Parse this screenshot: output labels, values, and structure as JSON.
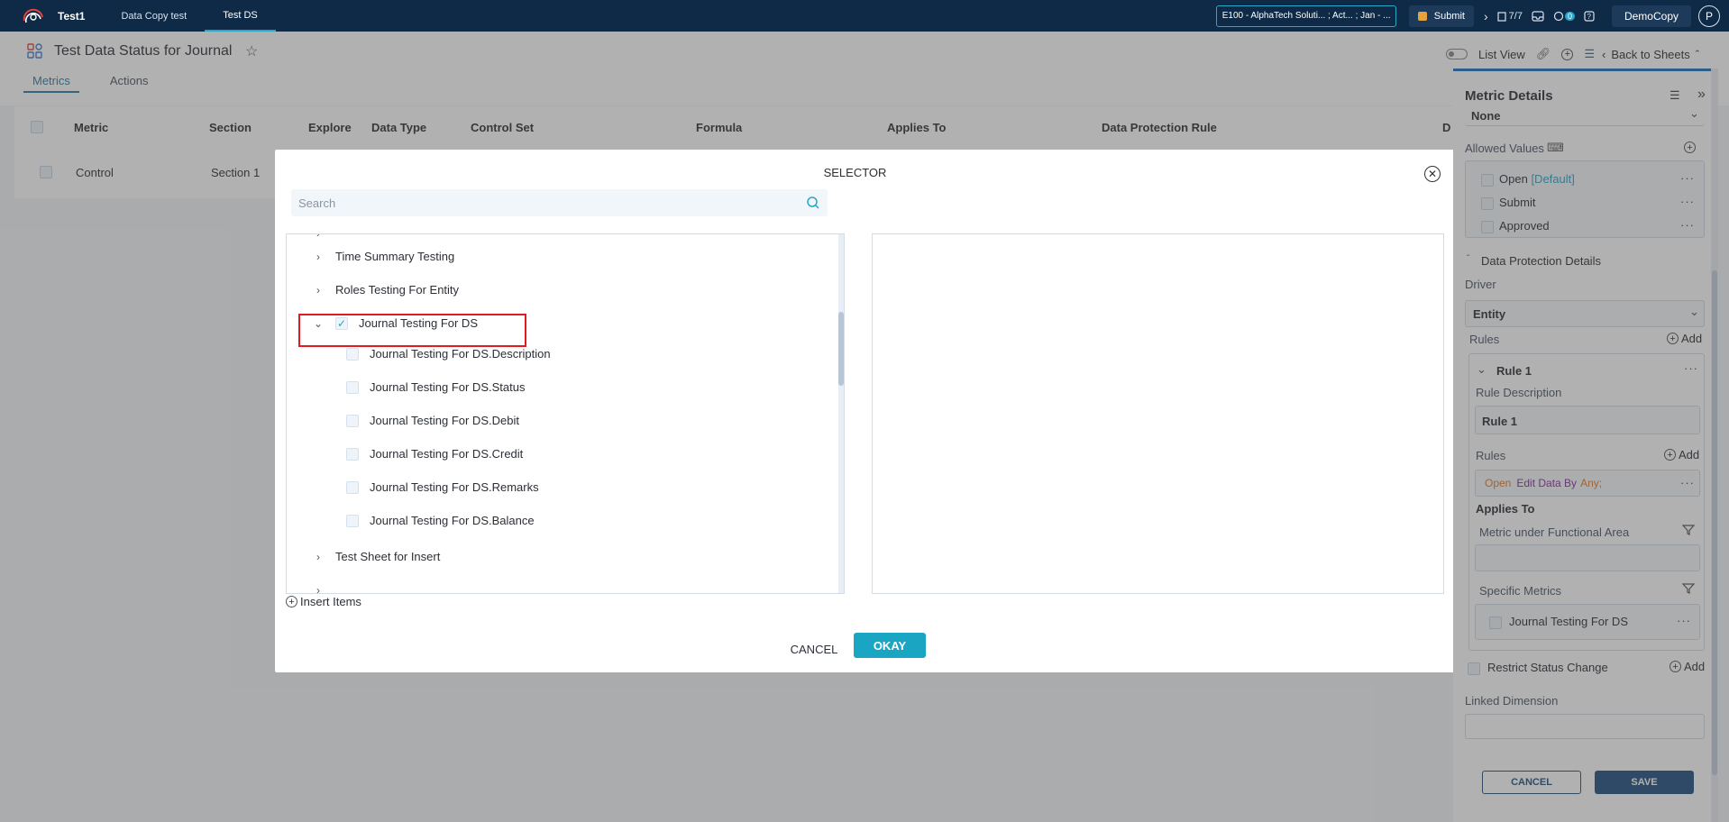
{
  "topbar": {
    "tabs": [
      "Test1",
      "Data Copy test",
      "Test DS"
    ],
    "context": "E100 - AlphaTech Soluti... ; Act... ; Jan - ...",
    "submit_label": "Submit",
    "task_count": "7/7",
    "notif_count": "0",
    "user_menu": "DemoCopy",
    "avatar_letter": "P"
  },
  "header": {
    "title": "Test Data Status for Journal",
    "tabs": [
      "Metrics",
      "Actions"
    ],
    "list_view": "List View",
    "back": "Back to Sheets"
  },
  "grid": {
    "columns": [
      "Metric",
      "Section",
      "Explore",
      "Data Type",
      "Control Set",
      "Formula",
      "Applies To",
      "Data Protection Rule",
      "D"
    ],
    "rows": [
      {
        "metric": "Control",
        "section": "Section 1"
      }
    ]
  },
  "modal": {
    "title": "SELECTOR",
    "search_placeholder": "Search",
    "tree": [
      {
        "label": "Time Summary Testing"
      },
      {
        "label": "Roles Testing For Entity"
      },
      {
        "label": "Journal Testing For DS"
      },
      {
        "label": "Journal Testing For DS.Description"
      },
      {
        "label": "Journal Testing For DS.Status"
      },
      {
        "label": "Journal Testing For DS.Debit"
      },
      {
        "label": "Journal Testing For DS.Credit"
      },
      {
        "label": "Journal Testing For DS.Remarks"
      },
      {
        "label": "Journal Testing For DS.Balance"
      },
      {
        "label": "Test Sheet for Insert"
      }
    ],
    "insert_items": "Insert Items",
    "cancel": "CANCEL",
    "okay": "OKAY"
  },
  "panel": {
    "title": "Metric Details",
    "none_value": "None",
    "allowed_values_label": "Allowed Values",
    "allowed_values": [
      {
        "label": "Open",
        "tag": "[Default]"
      },
      {
        "label": "Submit",
        "tag": ""
      },
      {
        "label": "Approved",
        "tag": ""
      }
    ],
    "dp_section": "Data Protection Details",
    "driver_label": "Driver",
    "driver_value": "Entity",
    "rules_label": "Rules",
    "add": "Add",
    "rule_name": "Rule 1",
    "rule_desc_label": "Rule Description",
    "rule_desc_value": "Rule 1",
    "rule_open": "Open",
    "rule_edit": "Edit Data By",
    "rule_any": "Any;",
    "applies_to": "Applies To",
    "metric_under_fa": "Metric under Functional Area",
    "specific_metrics": "Specific Metrics",
    "specific_metric_item": "Journal Testing For DS",
    "restrict_status": "Restrict Status Change",
    "linked_dimension": "Linked Dimension",
    "cancel": "CANCEL",
    "save": "SAVE"
  },
  "colors": {
    "topbar": "#0e2a47",
    "accent": "#1aa6c3",
    "highlight": "#e01b22",
    "panel_button": "#1e4f80"
  }
}
